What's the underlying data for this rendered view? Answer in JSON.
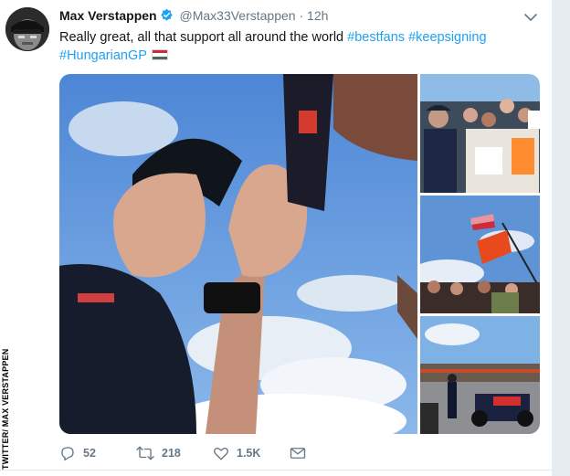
{
  "tweet": {
    "display_name": "Max Verstappen",
    "handle": "@Max33Verstappen",
    "separator": "·",
    "time": "12h",
    "text_plain": "Really great, all that support all around the world ",
    "hashtags": [
      "#bestfans",
      "#keepsigning",
      "#HungarianGP"
    ],
    "flag": "hungary-flag"
  },
  "actions": {
    "replies": "52",
    "retweets": "218",
    "likes": "1.5K"
  },
  "watermark": "TWITTER/ MAX VERSTAPPEN",
  "colors": {
    "link": "#1da1f2",
    "muted": "#657786",
    "verified": "#1da1f2",
    "text": "#14171a"
  },
  "icons": [
    "verified-badge-icon",
    "chevron-down-icon",
    "reply-icon",
    "retweet-icon",
    "like-icon",
    "message-icon"
  ]
}
